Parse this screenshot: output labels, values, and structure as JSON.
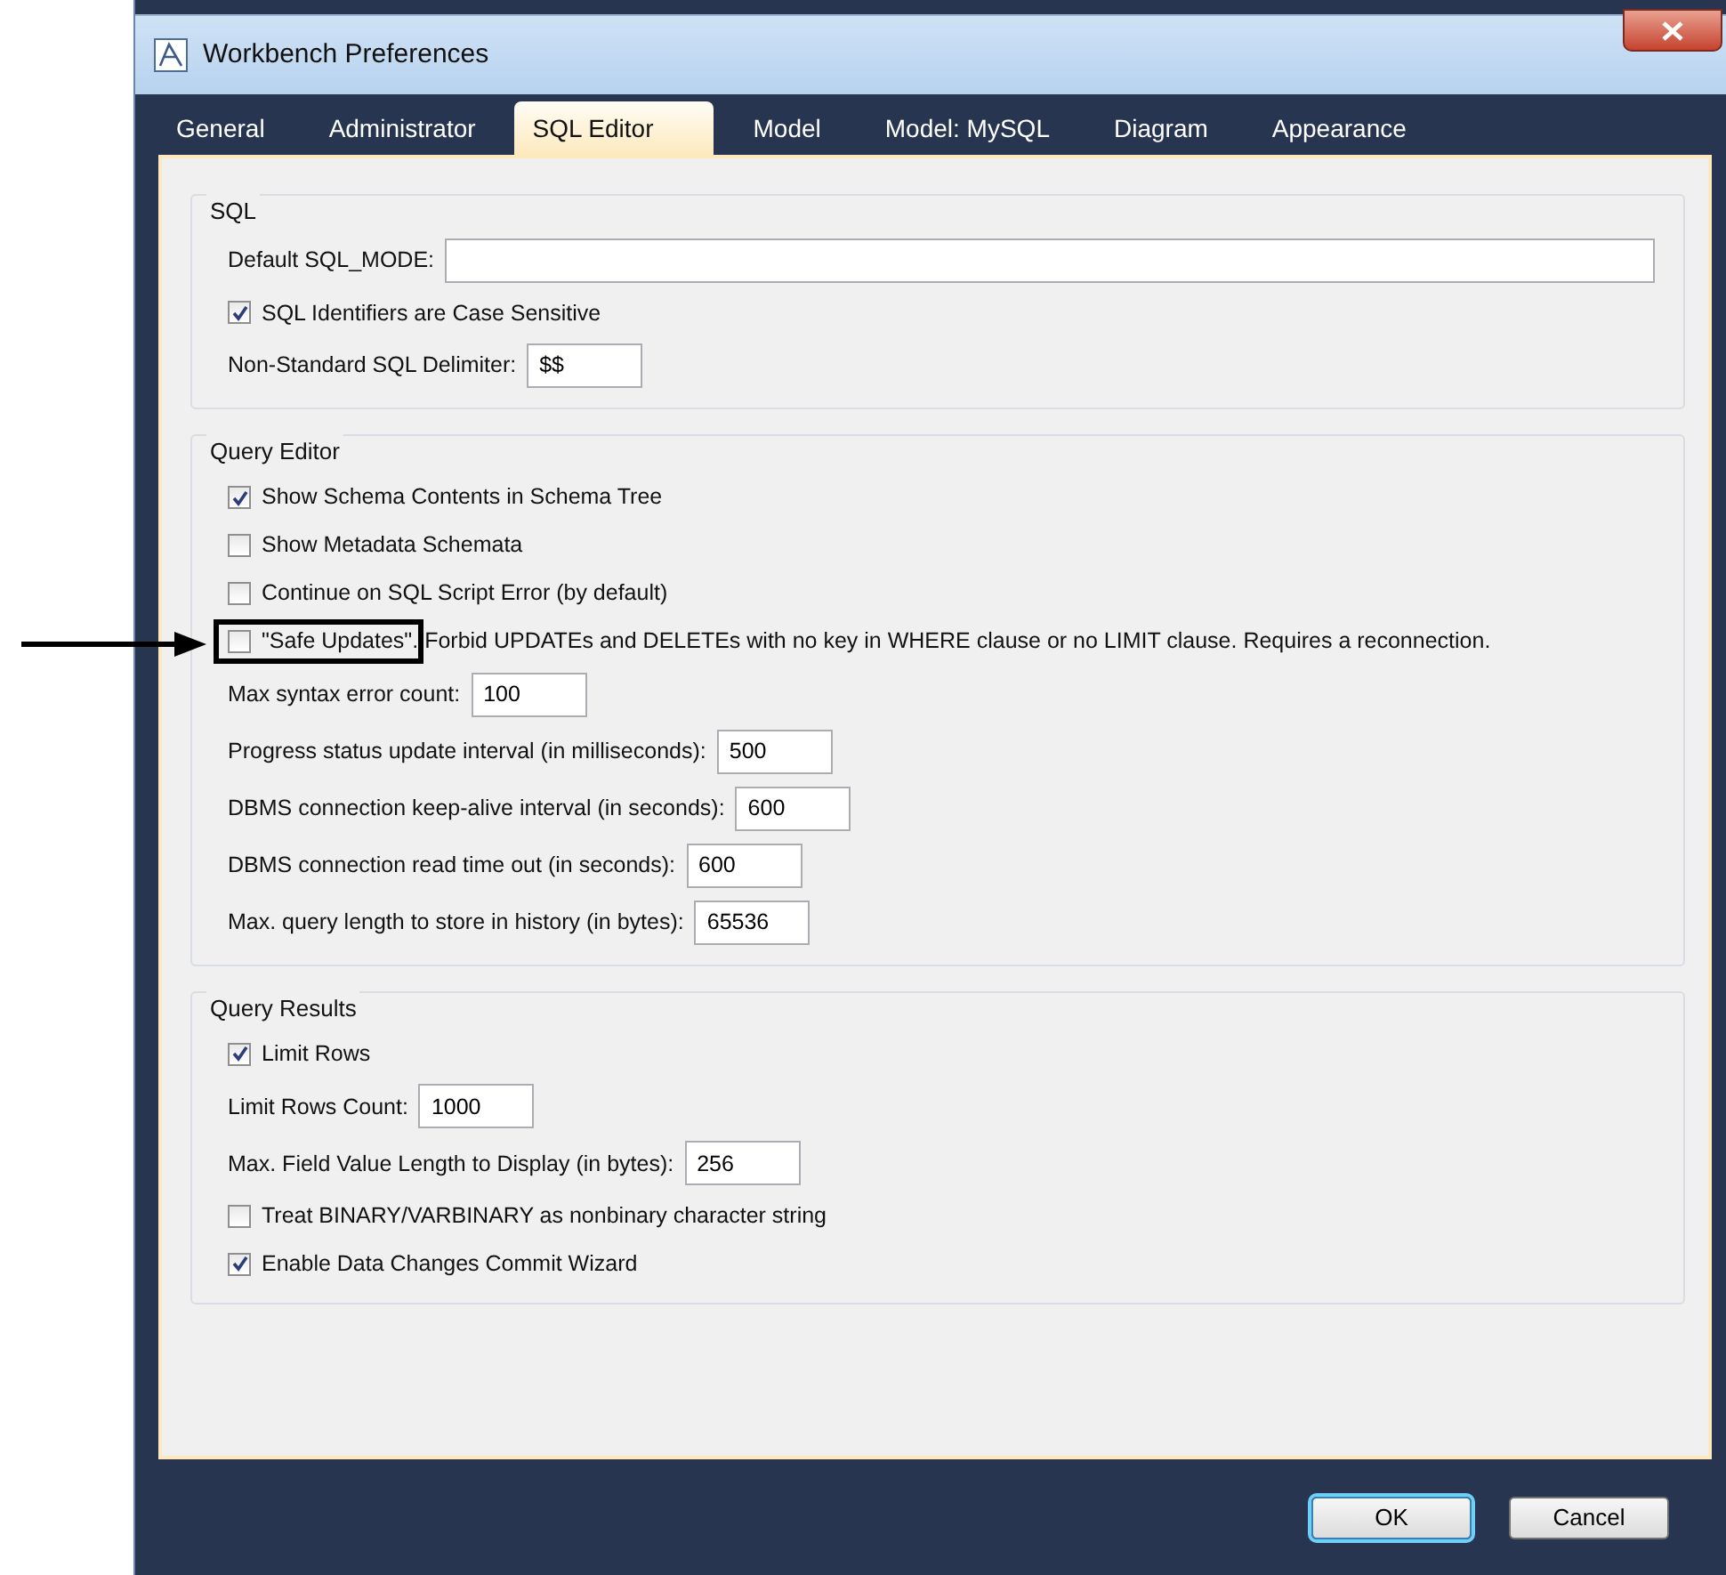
{
  "window": {
    "title": "Workbench Preferences"
  },
  "tabs": [
    {
      "label": "General",
      "selected": false
    },
    {
      "label": "Administrator",
      "selected": false
    },
    {
      "label": "SQL Editor",
      "selected": true
    },
    {
      "label": "Model",
      "selected": false
    },
    {
      "label": "Model: MySQL",
      "selected": false
    },
    {
      "label": "Diagram",
      "selected": false
    },
    {
      "label": "Appearance",
      "selected": false
    }
  ],
  "groups": [
    {
      "title": "SQL",
      "rows": [
        {
          "kind": "wide-field",
          "label": "Default SQL_MODE:",
          "value": ""
        },
        {
          "kind": "check",
          "label": "SQL Identifiers are Case Sensitive",
          "checked": true,
          "highlighted": false
        },
        {
          "kind": "field",
          "label": "Non-Standard SQL Delimiter:",
          "value": "$$"
        }
      ]
    },
    {
      "title": "Query Editor",
      "rows": [
        {
          "kind": "check",
          "label": "Show Schema Contents in Schema Tree",
          "checked": true,
          "highlighted": false
        },
        {
          "kind": "check",
          "label": "Show Metadata Schemata",
          "checked": false,
          "highlighted": false
        },
        {
          "kind": "check",
          "label": "Continue on SQL Script Error (by default)",
          "checked": false,
          "highlighted": false
        },
        {
          "kind": "check",
          "label": "\"Safe Updates\". Forbid UPDATEs and DELETEs with no key in WHERE clause or no LIMIT clause. Requires a reconnection.",
          "checked": false,
          "highlighted": true
        },
        {
          "kind": "field",
          "label": "Max syntax error count:",
          "value": "100"
        },
        {
          "kind": "field",
          "label": "Progress status update interval (in milliseconds):",
          "value": "500"
        },
        {
          "kind": "field",
          "label": "DBMS connection keep-alive interval (in seconds):",
          "value": "600"
        },
        {
          "kind": "field",
          "label": "DBMS connection read time out (in seconds):",
          "value": "600"
        },
        {
          "kind": "field",
          "label": "Max. query length to store in history (in bytes):",
          "value": "65536"
        }
      ]
    },
    {
      "title": "Query Results",
      "rows": [
        {
          "kind": "check",
          "label": "Limit Rows",
          "checked": true,
          "highlighted": false
        },
        {
          "kind": "field",
          "label": "Limit Rows Count:",
          "value": "1000"
        },
        {
          "kind": "field",
          "label": "Max. Field Value Length to Display (in bytes):",
          "value": "256"
        },
        {
          "kind": "check",
          "label": "Treat BINARY/VARBINARY as nonbinary character string",
          "checked": false,
          "highlighted": false
        },
        {
          "kind": "check",
          "label": "Enable Data Changes Commit Wizard",
          "checked": true,
          "highlighted": false
        }
      ]
    }
  ],
  "buttons": [
    {
      "label": "OK",
      "default": true
    },
    {
      "label": "Cancel",
      "default": false
    }
  ]
}
